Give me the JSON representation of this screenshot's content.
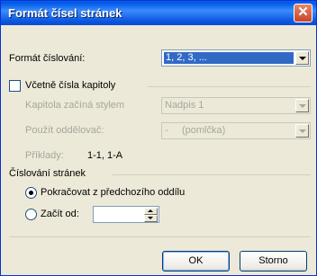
{
  "window": {
    "title": "Formát čísel stránek",
    "close_glyph": "✕"
  },
  "format": {
    "label": "Formát číslování:",
    "value": "1, 2, 3, ..."
  },
  "include_chapter": {
    "label": "Včetně čísla kapitoly",
    "checked": false
  },
  "chapter_style": {
    "label": "Kapitola začíná stylem",
    "value": "Nadpis 1"
  },
  "separator": {
    "label": "Použít oddělovač:",
    "value": "-     (pomlčka)"
  },
  "examples": {
    "label": "Příklady:",
    "value": "1-1, 1-A"
  },
  "page_numbering": {
    "label": "Číslování stránek",
    "continue_label": "Pokračovat z předchozího oddílu",
    "start_at_label": "Začít od:",
    "start_at_value": "",
    "selected": "continue"
  },
  "buttons": {
    "ok": "OK",
    "cancel": "Storno"
  }
}
